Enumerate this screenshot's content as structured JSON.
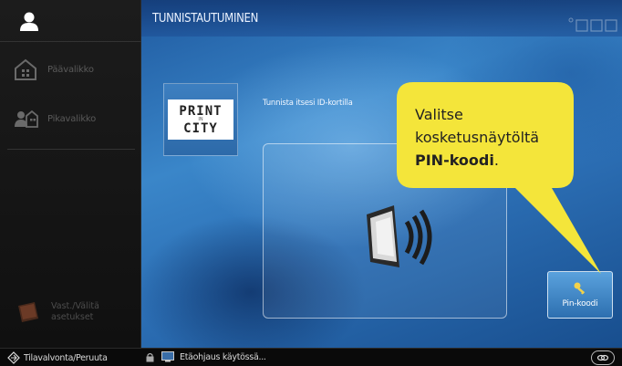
{
  "sidebar": {
    "user_icon": "user-icon",
    "items": [
      {
        "label": "Päävalikko",
        "icon": "home-icon"
      },
      {
        "label": "Pikavalikko",
        "icon": "quick-menu-icon"
      }
    ],
    "bottom": {
      "label_line1": "Vast./Välitä",
      "label_line2": "asetukset",
      "icon": "fax-forward-icon"
    }
  },
  "header": {
    "title": "TUNNISTAUTUMINEN"
  },
  "main": {
    "logo": {
      "line1": "PRINT",
      "middle": "IN",
      "line2": "CITY"
    },
    "instruction": "Tunnista itsesi ID-kortilla",
    "card_reader_icon": "card-reader-icon",
    "pin_button": {
      "label": "Pin-koodi",
      "icon": "key-icon"
    }
  },
  "callout": {
    "line1": "Valitse",
    "line2": "kosketusnäytöltä",
    "line3_bold": "PIN-koodi",
    "line3_end": "."
  },
  "statusbar": {
    "left_label": "Tilavalvonta/Peruuta",
    "middle_label": "Etäohjaus käytössä...",
    "right_icon": "link-icon"
  },
  "colors": {
    "callout_yellow": "#f4e53a",
    "main_blue": "#2c6fb5",
    "sidebar_dark": "#151515"
  }
}
